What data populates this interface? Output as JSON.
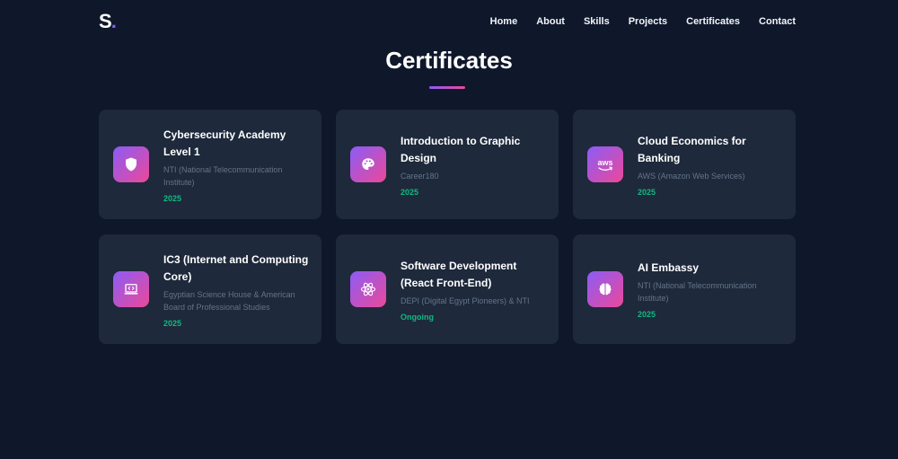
{
  "nav": {
    "logo_letter": "S",
    "logo_dot": ".",
    "links": [
      "Home",
      "About",
      "Skills",
      "Projects",
      "Certificates",
      "Contact"
    ]
  },
  "section": {
    "title": "Certificates"
  },
  "certificates": [
    {
      "title": "Cybersecurity Academy Level 1",
      "issuer": "NTI (National Telecommunication Institute)",
      "year": "2025",
      "icon": "shield-icon"
    },
    {
      "title": "Introduction to Graphic Design",
      "issuer": "Career180",
      "year": "2025",
      "icon": "palette-icon"
    },
    {
      "title": "Cloud Economics for Banking",
      "issuer": "AWS (Amazon Web Services)",
      "year": "2025",
      "icon": "aws-icon",
      "icon_text": "aws"
    },
    {
      "title": "IC3 (Internet and Computing Core)",
      "issuer": "Egyptian Science House & American Board of Professional Studies",
      "year": "2025",
      "icon": "laptop-code-icon"
    },
    {
      "title": "Software Development (React Front-End)",
      "issuer": "DEPI (Digital Egypt Pioneers) & NTI",
      "year": "Ongoing",
      "icon": "react-icon"
    },
    {
      "title": "AI Embassy",
      "issuer": "NTI (National Telecommunication Institute)",
      "year": "2025",
      "icon": "brain-icon"
    }
  ],
  "colors": {
    "background": "#0f172a",
    "card": "#1e293b",
    "accent_start": "#8b5cf6",
    "accent_end": "#ec4899",
    "year": "#10b981"
  }
}
